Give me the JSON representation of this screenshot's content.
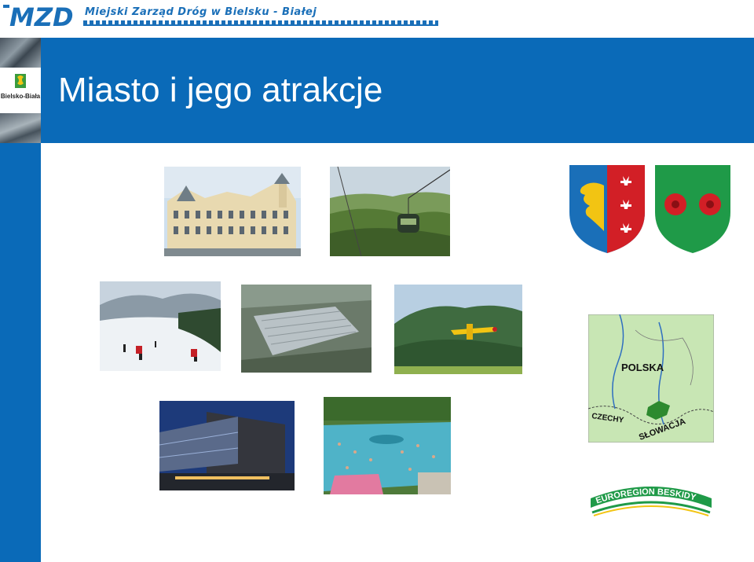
{
  "header": {
    "logo_text": "MZD",
    "org_name": "Miejski Zarząd Dróg w Bielsku - Białej"
  },
  "sidebar": {
    "city_logo_text": "Bielsko-Biała"
  },
  "slide": {
    "title": "Miasto i jego atrakcje"
  },
  "map": {
    "labels": [
      "POLSKA",
      "CZECHY",
      "SŁOWACJA"
    ]
  },
  "euroregion": {
    "text": "EUROREGION BESKIDY"
  },
  "colors": {
    "brand_blue": "#0a6ab8",
    "shield_red": "#d21f26",
    "shield_green": "#1f9a48"
  }
}
